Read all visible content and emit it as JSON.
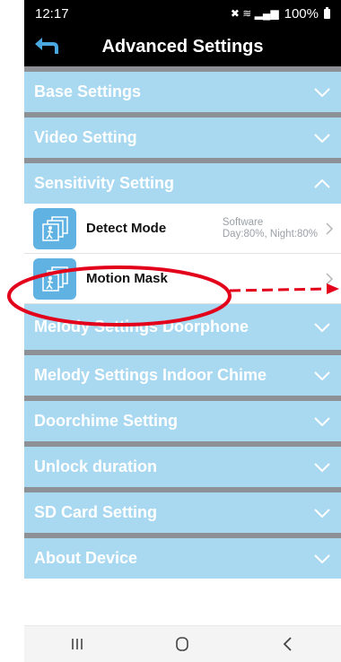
{
  "status": {
    "time": "12:17",
    "battery": "100%"
  },
  "header": {
    "title": "Advanced Settings"
  },
  "sections_top": [
    {
      "label": "Base Settings"
    },
    {
      "label": "Video Setting"
    },
    {
      "label": "Sensitivity Setting"
    }
  ],
  "sensitivity_items": [
    {
      "label": "Detect Mode",
      "detail_1": "Software",
      "detail_2": "Day:80%, Night:80%"
    },
    {
      "label": "Motion Mask"
    }
  ],
  "sections_bottom": [
    {
      "label": "Melody Settings Doorphone"
    },
    {
      "label": "Melody Settings Indoor Chime"
    },
    {
      "label": "Doorchime Setting"
    },
    {
      "label": "Unlock duration"
    },
    {
      "label": "SD Card Setting"
    },
    {
      "label": "About Device"
    }
  ],
  "colors": {
    "section_bg": "#a9d8f1",
    "annotation": "#e3001b",
    "icon_bg": "#5fb2e2"
  },
  "icons": [
    "back-arrow-icon",
    "chevron-down-icon",
    "chevron-up-icon",
    "chevron-right-icon",
    "motion-detection-icon",
    "recents-icon",
    "home-icon",
    "back-icon"
  ]
}
